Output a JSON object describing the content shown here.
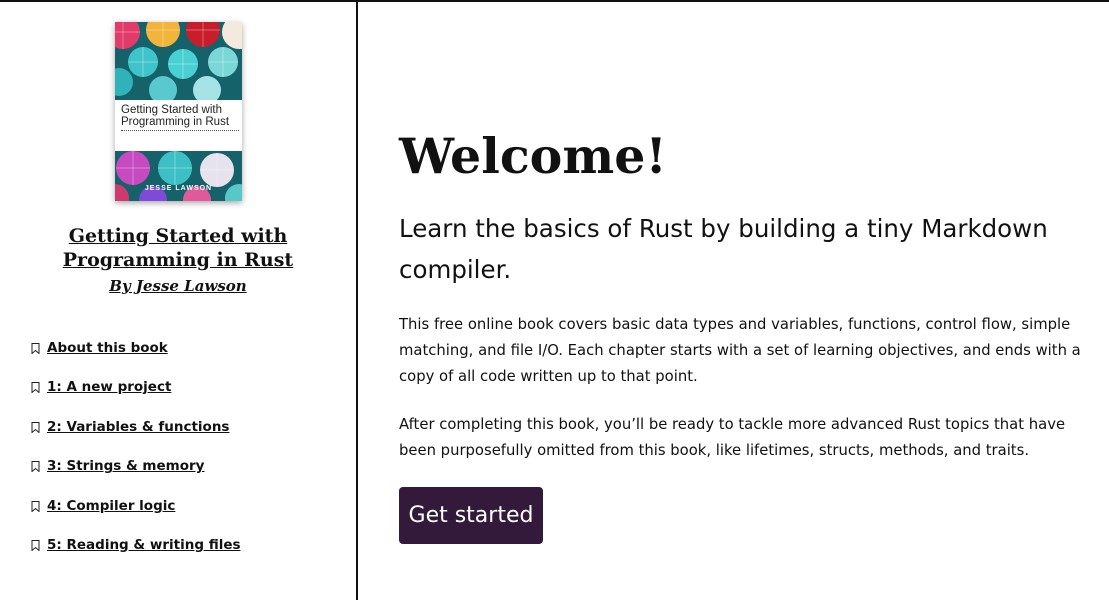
{
  "cover": {
    "title_line1": "Getting Started with",
    "title_line2": "Programming in Rust",
    "author": "JESSE LAWSON"
  },
  "sidebar": {
    "book_title_line1": "Getting Started with",
    "book_title_line2": "Programming in Rust",
    "author": "By Jesse Lawson",
    "toc": [
      {
        "label": "About this book",
        "icon": "bookmark-icon"
      },
      {
        "label": "1: A new project",
        "icon": "bookmark-icon"
      },
      {
        "label": "2: Variables & functions",
        "icon": "bookmark-icon"
      },
      {
        "label": "3: Strings & memory",
        "icon": "bookmark-icon"
      },
      {
        "label": "4: Compiler logic",
        "icon": "bookmark-icon"
      },
      {
        "label": "5: Reading & writing files",
        "icon": "bookmark-icon"
      }
    ]
  },
  "main": {
    "heading": "Welcome!",
    "lead": "Learn the basics of Rust by building a tiny Markdown compiler.",
    "paragraph1": "This free online book covers basic data types and variables, functions, control flow, simple matching, and file I/O. Each chapter starts with a set of learning objectives, and ends with a copy of all code written up to that point.",
    "paragraph2": "After completing this book, you’ll be ready to tackle more advanced Rust topics that have been purposefully omitted from this book, like lifetimes, structs, methods, and traits.",
    "cta_label": "Get started"
  },
  "colors": {
    "cta_background": "#331a3a",
    "divider": "#111111"
  }
}
